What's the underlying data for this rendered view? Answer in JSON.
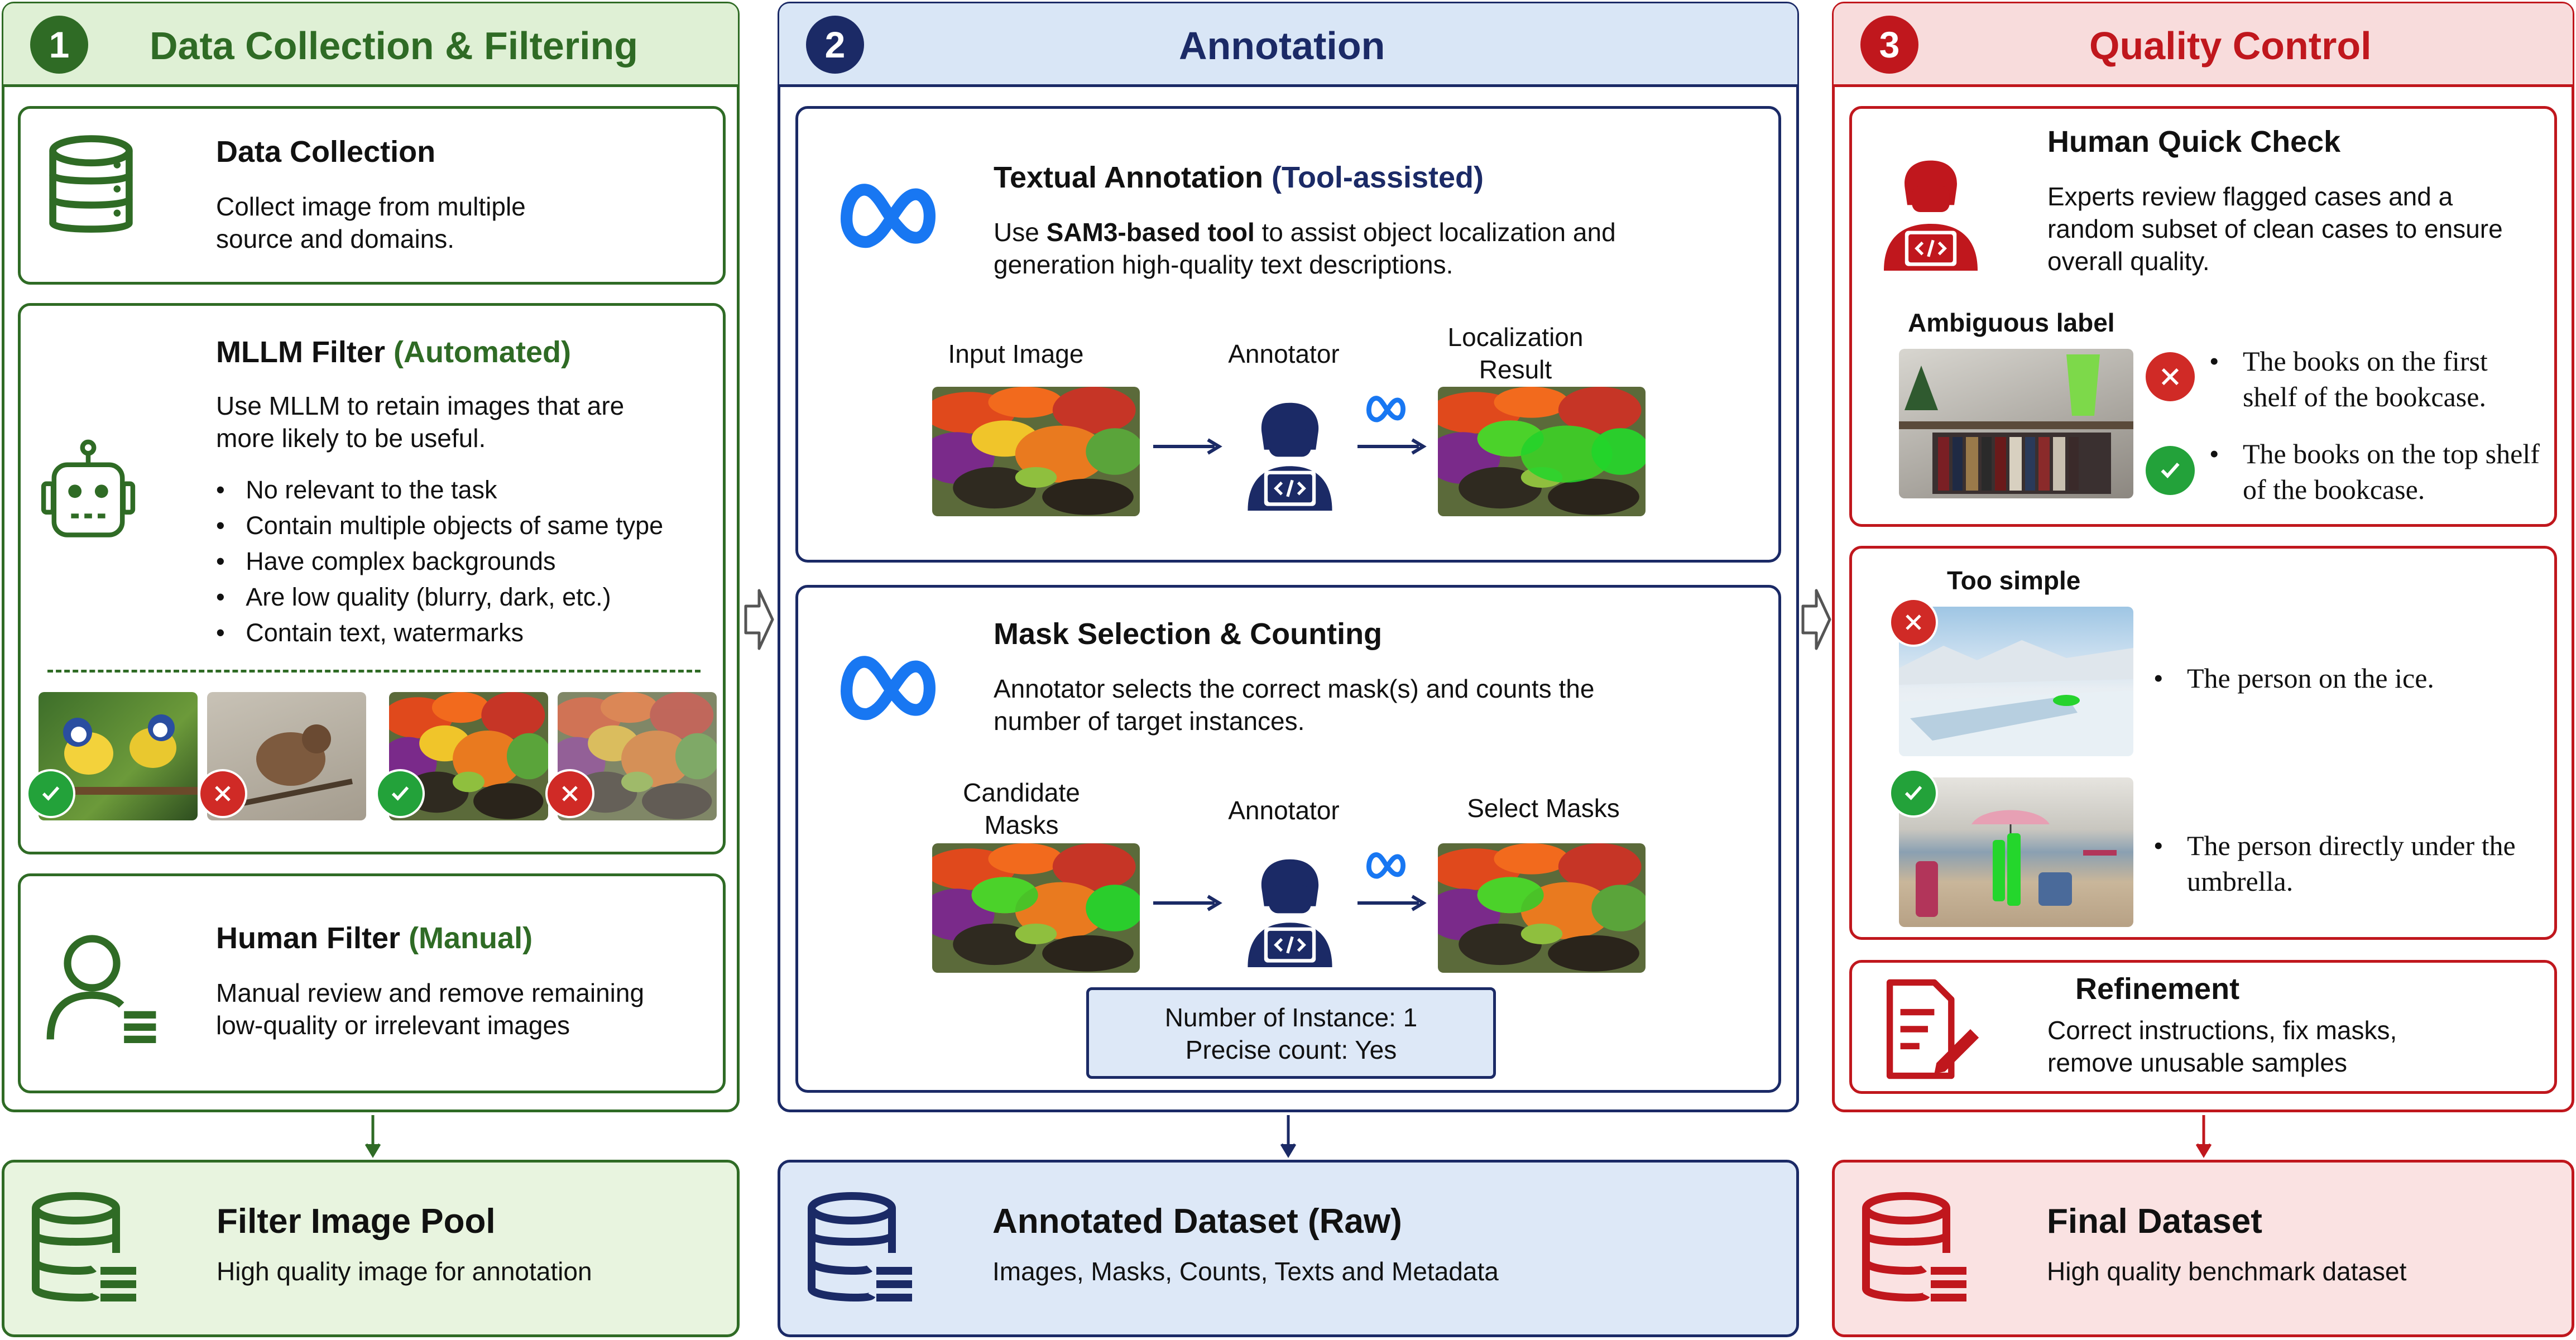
{
  "colors": {
    "green": "#2f6b25",
    "blue": "#1b2a66",
    "red": "#c0171d"
  },
  "stage1": {
    "number": "1",
    "title": "Data Collection & Filtering",
    "data_collection": {
      "title": "Data Collection",
      "text": "Collect image from multiple source and domains.",
      "icon": "database-icon"
    },
    "mllm_filter": {
      "title": "MLLM Filter",
      "tag": "(Automated)",
      "text": "Use MLLM to retain images that are more likely to be useful.",
      "bullets": [
        "No relevant to the task",
        "Contain multiple objects of same type",
        "Have complex backgrounds",
        "Are low quality (blurry, dark, etc.)",
        "Contain text, watermarks"
      ],
      "icon": "robot-icon",
      "examples": [
        "accepted",
        "rejected",
        "accepted",
        "rejected"
      ]
    },
    "human_filter": {
      "title": "Human Filter",
      "tag": "(Manual)",
      "text": "Manual review and remove remaining low-quality or irrelevant images",
      "icon": "user-list-icon"
    },
    "output": {
      "title": "Filter Image Pool",
      "text": "High quality image for annotation"
    }
  },
  "stage2": {
    "number": "2",
    "title": "Annotation",
    "textual": {
      "title": "Textual Annotation",
      "tag": "(Tool-assisted)",
      "text_prefix": "Use",
      "text_bold": "SAM3-based tool",
      "text_suffix": "to assist object localization and generation high-quality text descriptions.",
      "labels": [
        "Input Image",
        "Annotator",
        "Localization Result"
      ]
    },
    "mask": {
      "title": "Mask Selection & Counting",
      "text": "Annotator selects the correct mask(s) and counts the number of target instances.",
      "labels": [
        "Candidate Masks",
        "Annotator",
        "Select Masks"
      ],
      "count_line1": "Number of Instance: 1",
      "count_line2": "Precise count: Yes"
    },
    "output": {
      "title": "Annotated Dataset (Raw)",
      "text": "Images, Masks, Counts, Texts and Metadata"
    }
  },
  "stage3": {
    "number": "3",
    "title": "Quality Control",
    "quick_check": {
      "title": "Human Quick Check",
      "text": "Experts review flagged cases and a random subset of clean cases to ensure overall quality.",
      "case_label": "Ambiguous label",
      "bad_caption": "The books on the first shelf of the bookcase.",
      "good_caption": "The books on the top shelf of the bookcase."
    },
    "simple": {
      "label": "Too simple",
      "bad_caption": "The person on the ice.",
      "good_caption": "The person directly under the umbrella."
    },
    "refinement": {
      "title": "Refinement",
      "text": "Correct instructions, fix masks, remove unusable samples"
    },
    "output": {
      "title": "Final Dataset",
      "text": "High quality benchmark dataset"
    }
  }
}
